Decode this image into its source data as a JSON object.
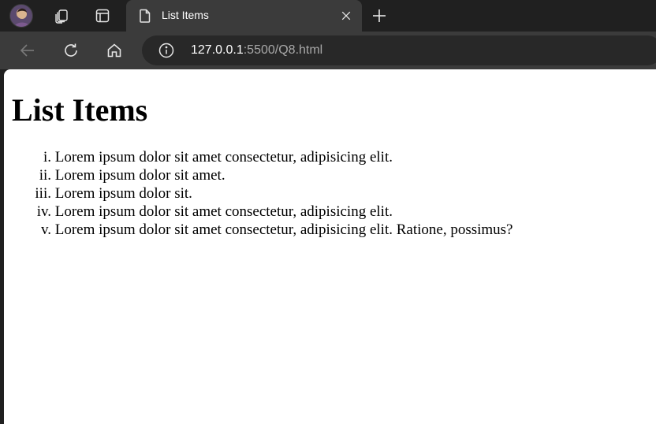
{
  "browser": {
    "tab": {
      "title": "List Items"
    },
    "address": {
      "host": "127.0.0.1",
      "rest": ":5500/Q8.html"
    },
    "icons": {
      "profile": "profile-avatar-icon",
      "workspaces": "workspaces-icon",
      "tab_actions": "tab-actions-icon",
      "page": "page-document-icon",
      "close": "close-icon",
      "new_tab": "plus-icon",
      "back": "back-arrow-icon",
      "reload": "reload-icon",
      "home": "home-icon",
      "info": "info-icon"
    }
  },
  "page": {
    "heading": "List Items",
    "list_items": [
      {
        "marker": "i.",
        "text": "Lorem ipsum dolor sit amet consectetur, adipisicing elit."
      },
      {
        "marker": "ii.",
        "text": "Lorem ipsum dolor sit amet."
      },
      {
        "marker": "iii.",
        "text": "Lorem ipsum dolor sit."
      },
      {
        "marker": "iv.",
        "text": "Lorem ipsum dolor sit amet consectetur, adipisicing elit."
      },
      {
        "marker": "v.",
        "text": "Lorem ipsum dolor sit amet consectetur, adipisicing elit. Ratione, possimus?"
      }
    ]
  },
  "colors": {
    "chrome_dark": "#202020",
    "chrome_mid": "#3b3b3b",
    "omnibox": "#282828",
    "icon": "#e6e6e6",
    "url_muted": "#a8a8a8"
  }
}
